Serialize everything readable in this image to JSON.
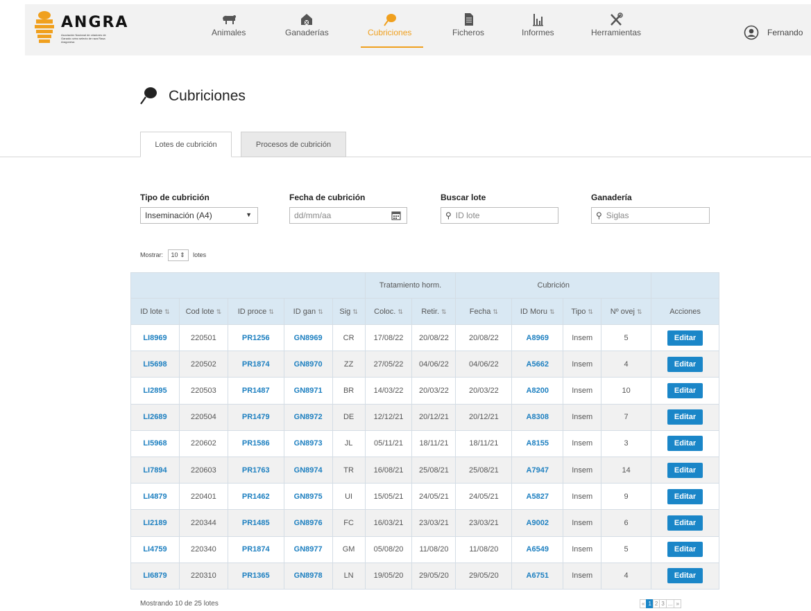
{
  "brand": {
    "name": "ANGRA",
    "subtitle": "Asociación Nacional de criadores de Ganado ovino selecto de raza Rasa Aragonesa"
  },
  "colors": {
    "accent": "#f0a01e",
    "link": "#1c7fc0",
    "button": "#1a86c8",
    "header_bg": "#d9e8f3"
  },
  "nav": {
    "items": [
      {
        "label": "Animales",
        "icon": "sheep-icon"
      },
      {
        "label": "Ganaderías",
        "icon": "barn-icon"
      },
      {
        "label": "Cubriciones",
        "icon": "breeding-icon",
        "active": true
      },
      {
        "label": "Ficheros",
        "icon": "file-icon"
      },
      {
        "label": "Informes",
        "icon": "bar-chart-icon"
      },
      {
        "label": "Herramientas",
        "icon": "tools-icon"
      }
    ]
  },
  "user": {
    "name": "Fernando",
    "icon": "user-icon"
  },
  "page": {
    "title": "Cubriciones"
  },
  "tabs": [
    {
      "label": "Lotes de cubrición",
      "active": true
    },
    {
      "label": "Procesos de cubrición",
      "active": false
    }
  ],
  "filters": {
    "tipo": {
      "label": "Tipo de cubrición",
      "value": "Inseminación (A4)"
    },
    "fecha": {
      "label": "Fecha de cubrición",
      "placeholder": "dd/mm/aa"
    },
    "buscar": {
      "label": "Buscar lote",
      "placeholder": "ID lote"
    },
    "ganaderia": {
      "label": "Ganadería",
      "placeholder": "Siglas"
    }
  },
  "show": {
    "prefix": "Mostrar:",
    "value": "10",
    "suffix": "lotes"
  },
  "table": {
    "groups": {
      "tratamiento": "Tratamiento horm.",
      "cubricion": "Cubrición"
    },
    "columns": [
      "ID lote",
      "Cod lote",
      "ID proce",
      "ID gan",
      "Sig",
      "Coloc.",
      "Retir.",
      "Fecha",
      "ID Moru",
      "Tipo",
      "Nº ovej",
      "Acciones"
    ],
    "action_label": "Editar",
    "rows": [
      [
        "LI8969",
        "220501",
        "PR1256",
        "GN8969",
        "CR",
        "17/08/22",
        "20/08/22",
        "20/08/22",
        "A8969",
        "Insem",
        "5"
      ],
      [
        "LI5698",
        "220502",
        "PR1874",
        "GN8970",
        "ZZ",
        "27/05/22",
        "04/06/22",
        "04/06/22",
        "A5662",
        "Insem",
        "4"
      ],
      [
        "LI2895",
        "220503",
        "PR1487",
        "GN8971",
        "BR",
        "14/03/22",
        "20/03/22",
        "20/03/22",
        "A8200",
        "Insem",
        "10"
      ],
      [
        "LI2689",
        "220504",
        "PR1479",
        "GN8972",
        "DE",
        "12/12/21",
        "20/12/21",
        "20/12/21",
        "A8308",
        "Insem",
        "7"
      ],
      [
        "LI5968",
        "220602",
        "PR1586",
        "GN8973",
        "JL",
        "05/11/21",
        "18/11/21",
        "18/11/21",
        "A8155",
        "Insem",
        "3"
      ],
      [
        "LI7894",
        "220603",
        "PR1763",
        "GN8974",
        "TR",
        "16/08/21",
        "25/08/21",
        "25/08/21",
        "A7947",
        "Insem",
        "14"
      ],
      [
        "LI4879",
        "220401",
        "PR1462",
        "GN8975",
        "UI",
        "15/05/21",
        "24/05/21",
        "24/05/21",
        "A5827",
        "Insem",
        "9"
      ],
      [
        "LI2189",
        "220344",
        "PR1485",
        "GN8976",
        "FC",
        "16/03/21",
        "23/03/21",
        "23/03/21",
        "A9002",
        "Insem",
        "6"
      ],
      [
        "LI4759",
        "220340",
        "PR1874",
        "GN8977",
        "GM",
        "05/08/20",
        "11/08/20",
        "11/08/20",
        "A6549",
        "Insem",
        "5"
      ],
      [
        "LI6879",
        "220310",
        "PR1365",
        "GN8978",
        "LN",
        "19/05/20",
        "29/05/20",
        "29/05/20",
        "A6751",
        "Insem",
        "4"
      ]
    ]
  },
  "footer": {
    "summary": "Mostrando 10 de 25 lotes",
    "pager": [
      "«",
      "1",
      "2",
      "3",
      "...",
      "»"
    ],
    "current_page": "1"
  }
}
